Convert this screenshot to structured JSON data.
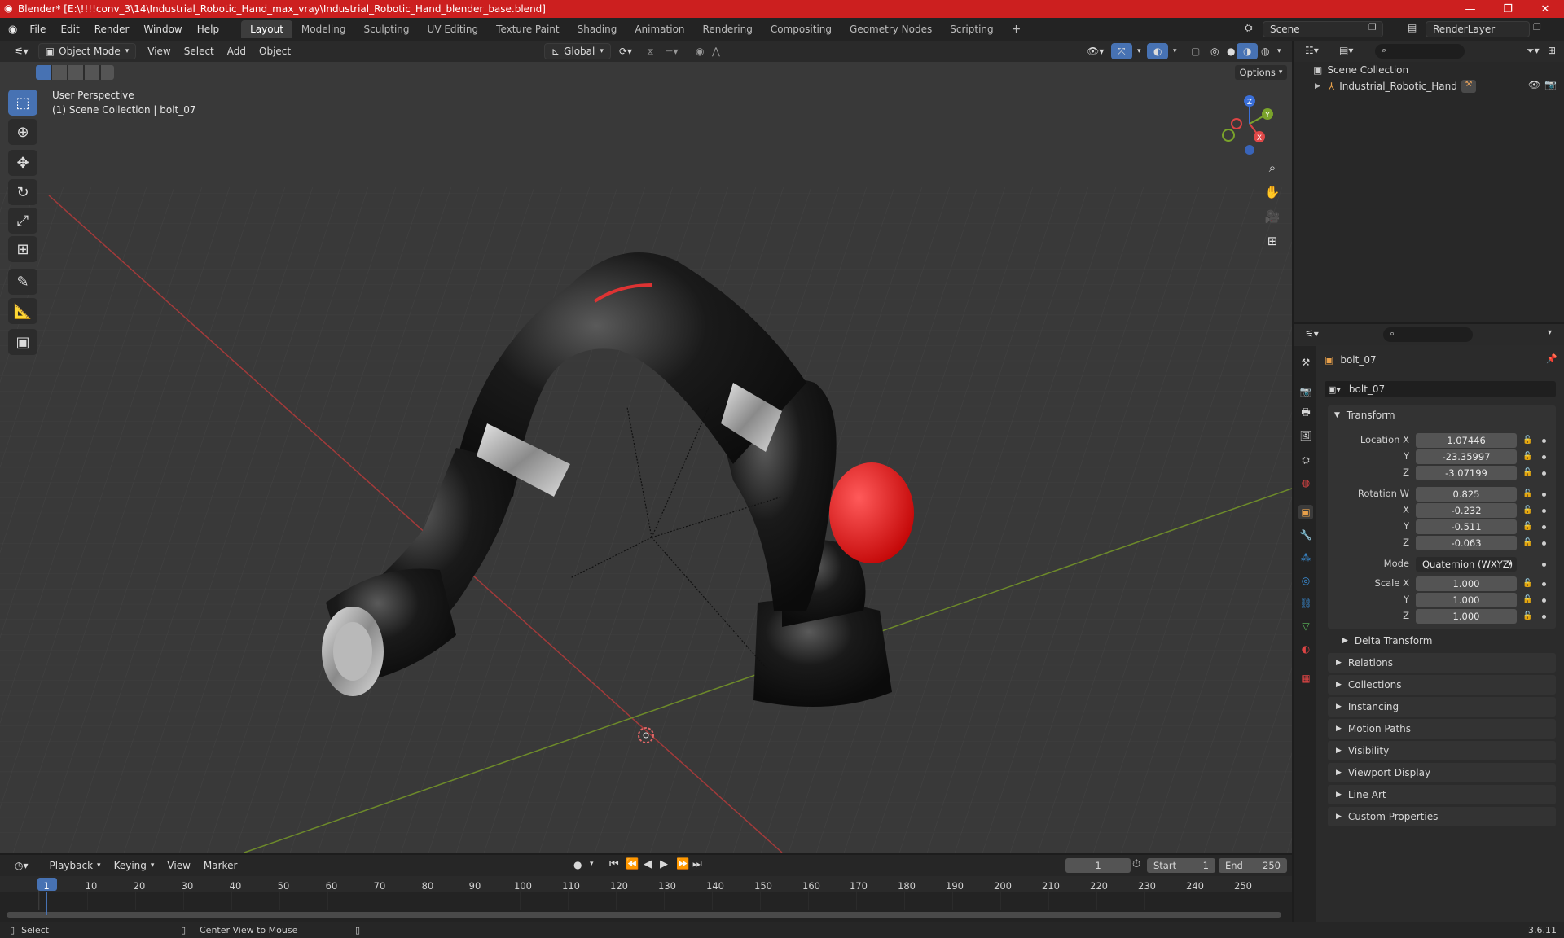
{
  "window": {
    "title": "Blender* [E:\\!!!!conv_3\\14\\Industrial_Robotic_Hand_max_vray\\Industrial_Robotic_Hand_blender_base.blend]"
  },
  "menu": [
    "File",
    "Edit",
    "Render",
    "Window",
    "Help"
  ],
  "workspaces": [
    "Layout",
    "Modeling",
    "Sculpting",
    "UV Editing",
    "Texture Paint",
    "Shading",
    "Animation",
    "Rendering",
    "Compositing",
    "Geometry Nodes",
    "Scripting"
  ],
  "scene": {
    "name": "Scene",
    "render_layer": "RenderLayer"
  },
  "viewport_header": {
    "mode": "Object Mode",
    "menus": [
      "View",
      "Select",
      "Add",
      "Object"
    ],
    "orientation": "Global",
    "options": "Options"
  },
  "viewport": {
    "perspective": "User Perspective",
    "collection": "(1) Scene Collection | bolt_07"
  },
  "gizmo": {
    "z": "Z",
    "y": "Y",
    "x": "X"
  },
  "outliner": {
    "root": "Scene Collection",
    "items": [
      {
        "name": "Industrial_Robotic_Hand"
      }
    ]
  },
  "properties": {
    "object_name": "bolt_07",
    "data_name": "bolt_07",
    "transform_label": "Transform",
    "location": {
      "label": "Location X",
      "x": "1.07446",
      "y": "-23.35997",
      "z": "-3.07199"
    },
    "rotation": {
      "label": "Rotation W",
      "w": "0.825",
      "x": "-0.232",
      "y": "-0.511",
      "z": "-0.063"
    },
    "mode_label": "Mode",
    "mode": "Quaternion (WXYZ)",
    "scale": {
      "label": "Scale X",
      "x": "1.000",
      "y": "1.000",
      "z": "1.000"
    },
    "axis_y": "Y",
    "axis_z": "Z",
    "axis_x": "X",
    "delta": "Delta Transform",
    "sections": [
      "Relations",
      "Collections",
      "Instancing",
      "Motion Paths",
      "Visibility",
      "Viewport Display",
      "Line Art",
      "Custom Properties"
    ]
  },
  "timeline": {
    "menus": [
      "Playback",
      "Keying",
      "View",
      "Marker"
    ],
    "current_frame": "1",
    "start_label": "Start",
    "start": "1",
    "end_label": "End",
    "end": "250",
    "ticks": [
      "1",
      "10",
      "20",
      "30",
      "40",
      "50",
      "60",
      "70",
      "80",
      "90",
      "100",
      "110",
      "120",
      "130",
      "140",
      "150",
      "160",
      "170",
      "180",
      "190",
      "200",
      "210",
      "220",
      "230",
      "240",
      "250"
    ]
  },
  "statusbar": {
    "select": "Select",
    "center": "Center View to Mouse",
    "version": "3.6.11"
  },
  "colors": {
    "accent": "#4772b3",
    "titlebar": "#cc1f1f",
    "active_frame": "#4772b3"
  }
}
